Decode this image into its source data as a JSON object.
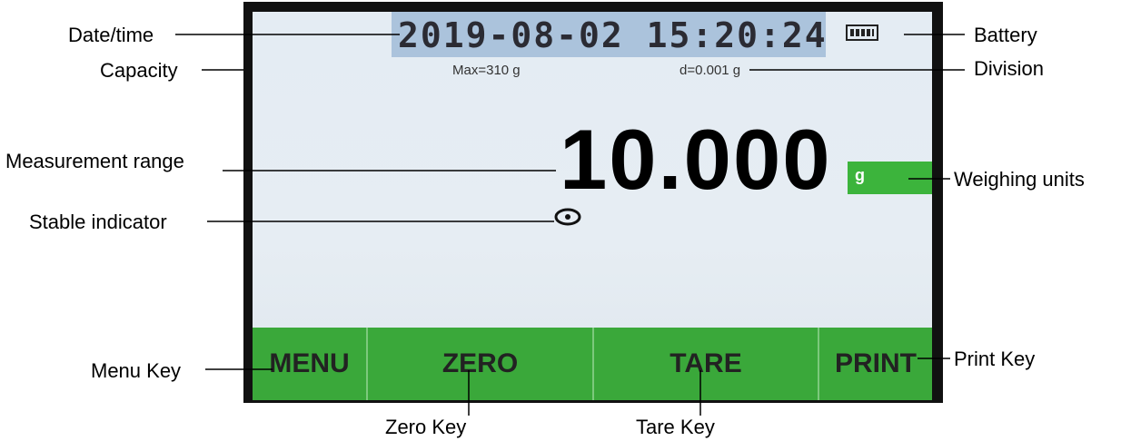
{
  "labels": {
    "date_time": "Date/time",
    "capacity": "Capacity",
    "measurement_range": "Measurement range",
    "stable_indicator": "Stable indicator",
    "menu_key": "Menu Key",
    "battery": "Battery",
    "division": "Division",
    "weighing_units": "Weighing units",
    "print_key": "Print  Key",
    "zero_key": "Zero  Key",
    "tare_key": "Tare  Key"
  },
  "screen": {
    "datetime": "2019-08-02 15:20:24",
    "max": "Max=310 g",
    "division": "d=0.001 g",
    "reading": "10.000",
    "unit": "g",
    "keys": {
      "menu": "MENU",
      "zero": "ZERO",
      "tare": "TARE",
      "print": "PRINT"
    }
  },
  "colors": {
    "key_green": "#3aa83a",
    "datetime_bg": "#abc3dc",
    "bezel": "#111111"
  }
}
